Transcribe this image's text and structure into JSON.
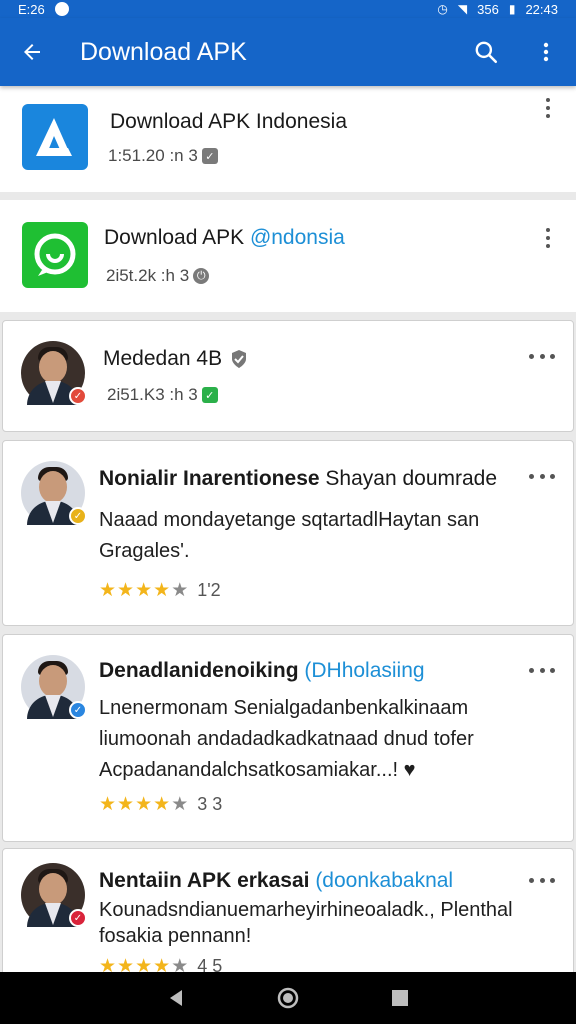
{
  "status_bar": {
    "time_left": "E:26",
    "signal": "356",
    "time_right": "22:43"
  },
  "app_bar": {
    "title": "Download APK"
  },
  "apps": [
    {
      "title": "Download APK Indonesia",
      "meta": "1:51.20 :n  3"
    },
    {
      "title": "Download APK ",
      "title_accent": "@ndonsia",
      "meta": "2i5t.2k :h  3"
    }
  ],
  "profile": {
    "name": "Mededan 4B",
    "meta": "2i51.K3 :h  3"
  },
  "reviews": [
    {
      "title": "Nonialir Inarentionese",
      "title_rest": " Shayan doumrade",
      "text": "Naaad mondayetange sqtartadlHaytan san Gragales'.",
      "rating_value": 4,
      "rating_text": "1'2"
    },
    {
      "title": "Denadlanidenoiking",
      "title_accent": " (DHholasiing",
      "text": "Lnenermonam Senialgadanbenkalkinaam liumoonah andadadkadkatnaad dnud tofer Acpadanandalchsatkosamiakar...! ♥",
      "rating_value": 4,
      "rating_text": "3 3"
    },
    {
      "title": "Nentaiin APK  erkasai",
      "title_accent": " (doonkabaknal",
      "text": "Kounadsndianuemarheyirhineoaladk., Plenthal fosakia pennann!",
      "rating_value": 4,
      "rating_text": "4 5"
    }
  ],
  "colors": {
    "primary": "#1565c8",
    "accent": "#1d8fd6",
    "star": "#f3b51b"
  }
}
